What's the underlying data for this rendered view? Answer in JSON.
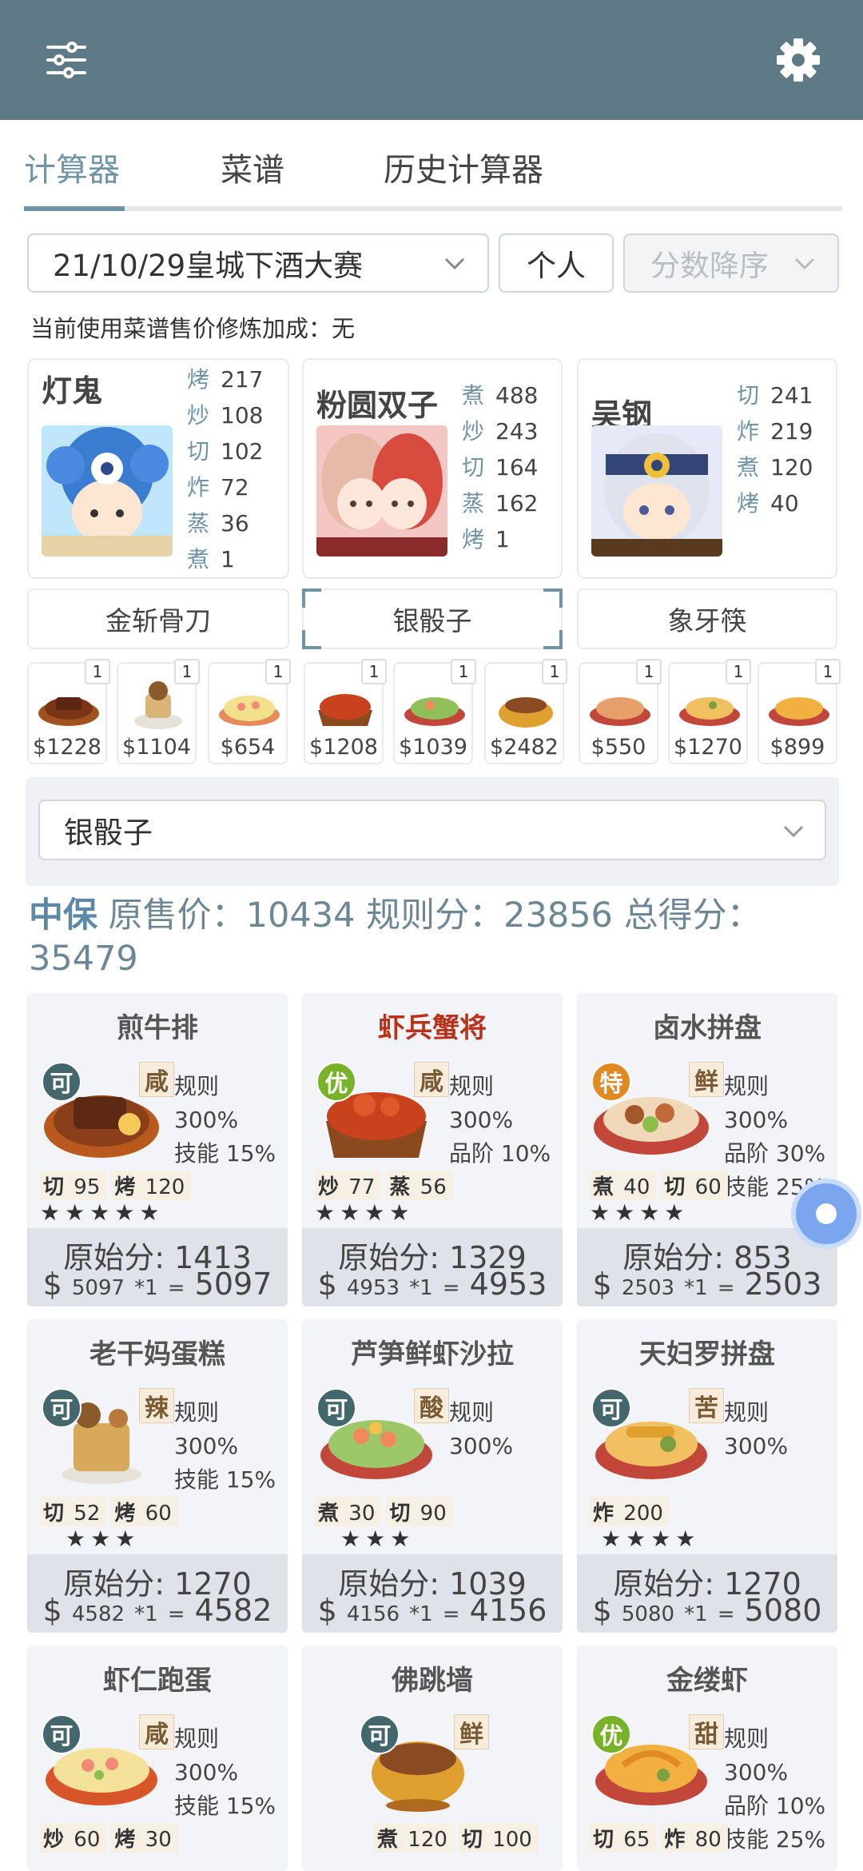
{
  "colors": {
    "topbar": "#5e7a87",
    "accent": "#6f94a6",
    "card_bg": "#f3f4f7",
    "score_bg": "#dfe2e8",
    "fab": "#7aa5ef",
    "grade_ke": "#44676e",
    "grade_you": "#78b22a",
    "grade_te": "#e08a22"
  },
  "header": {
    "menu_icon": "sliders-icon",
    "settings_icon": "gear-icon"
  },
  "tabs": [
    {
      "label": "计算器",
      "active": true
    },
    {
      "label": "菜谱"
    },
    {
      "label": "历史计算器"
    }
  ],
  "filters": {
    "contest": "21/10/29皇城下酒大赛",
    "mode": "个人",
    "sort": "分数降序"
  },
  "info_text": "当前使用菜谱售价修炼加成：无",
  "chefs": [
    {
      "name": "灯鬼",
      "stats": [
        {
          "k": "烤",
          "v": "217"
        },
        {
          "k": "炒",
          "v": "108"
        },
        {
          "k": "切",
          "v": "102"
        },
        {
          "k": "炸",
          "v": "72"
        },
        {
          "k": "蒸",
          "v": "36"
        },
        {
          "k": "煮",
          "v": "1"
        }
      ]
    },
    {
      "name": "粉圆双子",
      "stats": [
        {
          "k": "煮",
          "v": "488"
        },
        {
          "k": "炒",
          "v": "243"
        },
        {
          "k": "切",
          "v": "164"
        },
        {
          "k": "蒸",
          "v": "162"
        },
        {
          "k": "烤",
          "v": "1"
        }
      ]
    },
    {
      "name": "吴钢",
      "stats": [
        {
          "k": "切",
          "v": "241"
        },
        {
          "k": "炸",
          "v": "219"
        },
        {
          "k": "煮",
          "v": "120"
        },
        {
          "k": "烤",
          "v": "40"
        }
      ]
    }
  ],
  "equipment": [
    {
      "label": "金斩骨刀"
    },
    {
      "label": "银骰子",
      "selected": true
    },
    {
      "label": "象牙筷"
    }
  ],
  "small_dishes": [
    {
      "qty": "1",
      "price": "$1228"
    },
    {
      "qty": "1",
      "price": "$1104"
    },
    {
      "qty": "1",
      "price": "$654"
    },
    {
      "qty": "1",
      "price": "$1208"
    },
    {
      "qty": "1",
      "price": "$1039"
    },
    {
      "qty": "1",
      "price": "$2482"
    },
    {
      "qty": "1",
      "price": "$550"
    },
    {
      "qty": "1",
      "price": "$1270"
    },
    {
      "qty": "1",
      "price": "$899"
    }
  ],
  "equip_select": "银骰子",
  "summary": {
    "label": "中保",
    "text": "原售价：10434 规则分：23856 总得分：35479"
  },
  "dishes": [
    {
      "name": "煎牛排",
      "grade": "可",
      "flavor": "咸",
      "rules": [
        "规则 300%",
        "技能 15%"
      ],
      "skills": [
        {
          "k": "切",
          "v": "95"
        },
        {
          "k": "烤",
          "v": "120"
        }
      ],
      "stars": "★★★★★",
      "raw": "原始分: 1413",
      "price": "5097",
      "mult": "*1",
      "total": "5097"
    },
    {
      "name": "虾兵蟹将",
      "grade": "优",
      "flavor": "咸",
      "rules": [
        "规则 300%",
        "品阶 10%"
      ],
      "skills": [
        {
          "k": "炒",
          "v": "77"
        },
        {
          "k": "蒸",
          "v": "56"
        }
      ],
      "stars": "★★★★",
      "raw": "原始分: 1329",
      "price": "4953",
      "mult": "*1",
      "total": "4953",
      "red": true
    },
    {
      "name": "卤水拼盘",
      "grade": "特",
      "flavor": "鲜",
      "rules": [
        "规则 300%",
        "品阶 30%",
        "技能 25%"
      ],
      "skills": [
        {
          "k": "煮",
          "v": "40"
        },
        {
          "k": "切",
          "v": "60"
        }
      ],
      "stars": "★★★★",
      "raw": "原始分: 853",
      "price": "2503",
      "mult": "*1",
      "total": "2503"
    },
    {
      "name": "老干妈蛋糕",
      "grade": "可",
      "flavor": "辣",
      "rules": [
        "规则 300%",
        "技能 15%"
      ],
      "skills": [
        {
          "k": "切",
          "v": "52"
        },
        {
          "k": "烤",
          "v": "60"
        }
      ],
      "stars": "★★★",
      "raw": "原始分: 1270",
      "price": "4582",
      "mult": "*1",
      "total": "4582"
    },
    {
      "name": "芦笋鲜虾沙拉",
      "grade": "可",
      "flavor": "酸",
      "rules": [
        "规则 300%"
      ],
      "skills": [
        {
          "k": "煮",
          "v": "30"
        },
        {
          "k": "切",
          "v": "90"
        }
      ],
      "stars": "★★★",
      "raw": "原始分: 1039",
      "price": "4156",
      "mult": "*1",
      "total": "4156"
    },
    {
      "name": "天妇罗拼盘",
      "grade": "可",
      "flavor": "苦",
      "rules": [
        "规则 300%"
      ],
      "skills": [
        {
          "k": "炸",
          "v": "200"
        }
      ],
      "stars": "★★★★",
      "raw": "原始分: 1270",
      "price": "5080",
      "mult": "*1",
      "total": "5080"
    },
    {
      "name": "虾仁跑蛋",
      "grade": "可",
      "flavor": "咸",
      "rules": [
        "规则 300%",
        "技能 15%"
      ],
      "skills": [
        {
          "k": "炒",
          "v": "60"
        },
        {
          "k": "烤",
          "v": "30"
        }
      ]
    },
    {
      "name": "佛跳墙",
      "grade": "可",
      "flavor": "鲜",
      "rules": [],
      "skills": [
        {
          "k": "煮",
          "v": "120"
        },
        {
          "k": "切",
          "v": "100"
        }
      ]
    },
    {
      "name": "金缕虾",
      "grade": "优",
      "flavor": "甜",
      "rules": [
        "规则 300%",
        "品阶 10%",
        "技能 25%"
      ],
      "skills": [
        {
          "k": "切",
          "v": "65"
        },
        {
          "k": "炸",
          "v": "80"
        }
      ]
    }
  ]
}
